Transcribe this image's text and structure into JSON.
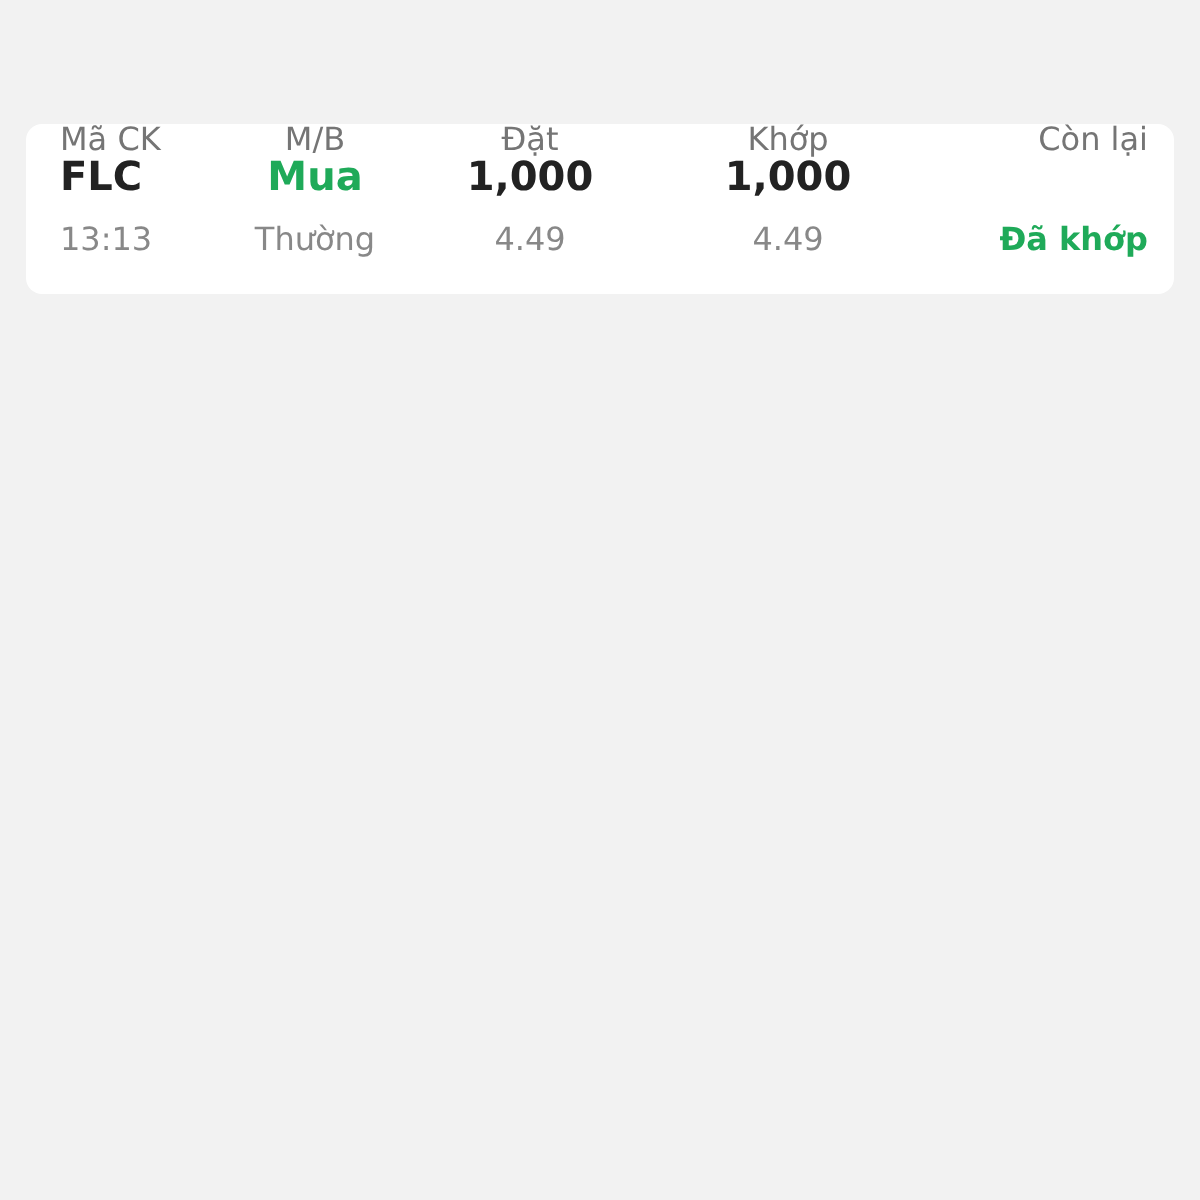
{
  "table": {
    "columns": [
      "Mã CK",
      "M/B",
      "Đặt",
      "Khớp",
      "Còn lại"
    ],
    "rows": [
      {
        "symbol": "FLC",
        "time": "13:13",
        "side": {
          "text": "Mua",
          "kind": "buy"
        },
        "order_type": "Thường",
        "ordered_qty": "1,000",
        "ordered_price": "4.49",
        "matched_qty": "1,000",
        "matched_price": "4.49",
        "status": {
          "text": "Đã khớp",
          "kind": "matched"
        }
      }
    ]
  }
}
